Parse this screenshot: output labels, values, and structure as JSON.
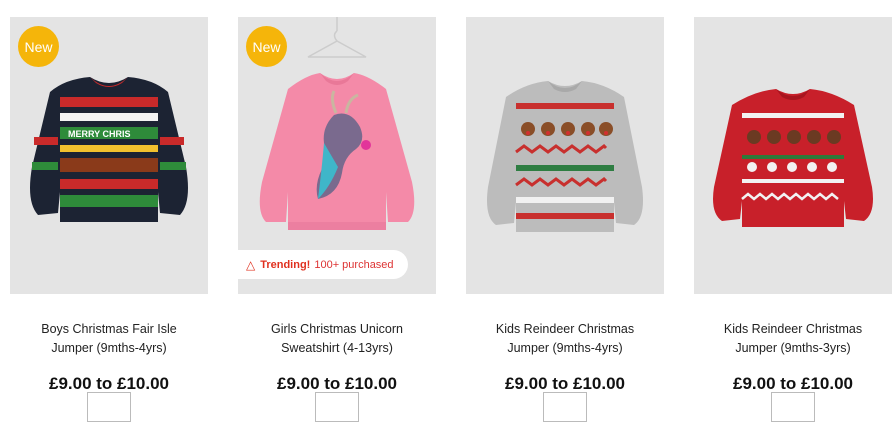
{
  "products": [
    {
      "title": "Boys Christmas Fair Isle Jumper (9mths-4yrs)",
      "title_l1": "Boys Christmas Fair Isle",
      "title_l2": "Jumper (9mths-4yrs)",
      "price": "£9.00 to £10.00",
      "badge": "New",
      "image": "navy-christmas-fair-isle-jumper"
    },
    {
      "title": "Girls Christmas Unicorn Sweatshirt (4-13yrs)",
      "title_l1": "Girls Christmas Unicorn",
      "title_l2": "Sweatshirt (4-13yrs)",
      "price": "£9.00 to £10.00",
      "badge": "New",
      "image": "pink-sequin-unicorn-sweatshirt",
      "trending": {
        "icon": "fire-icon",
        "label": "Trending!",
        "count": "100+ purchased"
      }
    },
    {
      "title": "Kids Reindeer Christmas Jumper (9mths-4yrs)",
      "title_l1": "Kids Reindeer Christmas",
      "title_l2": "Jumper (9mths-4yrs)",
      "price": "£9.00 to £10.00",
      "image": "grey-reindeer-jumper"
    },
    {
      "title": "Kids Reindeer Christmas Jumper (9mths-3yrs)",
      "title_l1": "Kids Reindeer Christmas",
      "title_l2": "Jumper (9mths-3yrs)",
      "price": "£9.00 to £10.00",
      "image": "red-reindeer-jumper"
    }
  ],
  "colors": {
    "badge": "#f5b50a",
    "trending": "#e0301e",
    "image_bg": "#e4e4e4"
  }
}
